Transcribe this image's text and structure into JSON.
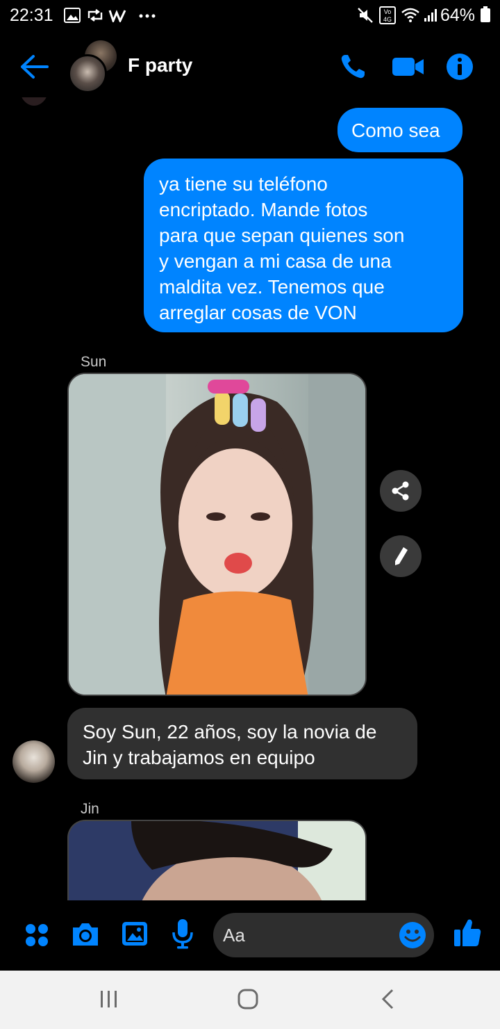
{
  "status_bar": {
    "time": "22:31",
    "battery": "64%",
    "icons": [
      "gallery-icon",
      "retweet-icon",
      "w-app-icon",
      "more-dots-icon",
      "mute-icon",
      "volte-icon",
      "wifi-icon",
      "signal-icon",
      "battery-icon"
    ]
  },
  "header": {
    "title": "F party",
    "accent": "#0084ff",
    "icons": [
      "back-arrow-icon",
      "phone-icon",
      "video-camera-icon",
      "info-icon"
    ]
  },
  "messages": {
    "out_1": "Como sea",
    "out_2_lines": [
      "ya tiene su teléfono",
      "encriptado. Mande fotos",
      "para que sepan quienes son",
      "y vengan a mi casa de una",
      "maldita vez. Tenemos que",
      "arreglar cosas de VON"
    ],
    "sender_sun": "Sun",
    "in_1_lines": [
      "Soy Sun, 22 años, soy la novia de",
      "Jin y trabajamos en equipo"
    ],
    "sender_jin": "Jin",
    "photo_side_icons": [
      "share-icon",
      "edit-pencil-icon"
    ]
  },
  "composer": {
    "placeholder": "Aa",
    "icons": [
      "apps-dots-icon",
      "camera-icon",
      "image-icon",
      "microphone-icon",
      "emoji-icon",
      "thumbs-up-icon"
    ]
  },
  "nav_bar": {
    "icons": [
      "recents-icon",
      "home-icon",
      "back-icon"
    ]
  }
}
